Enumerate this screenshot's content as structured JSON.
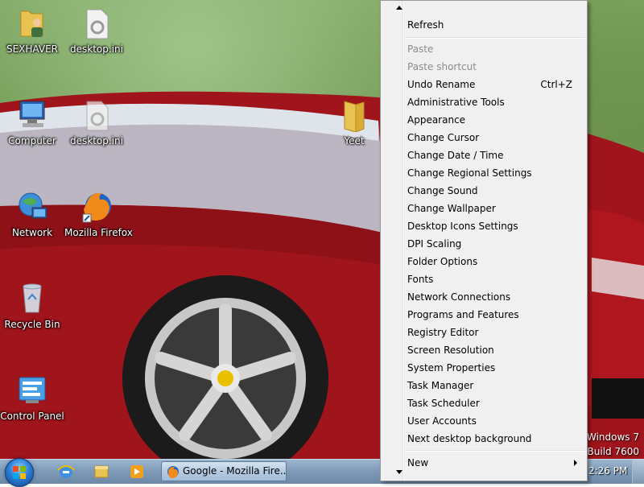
{
  "desktop": {
    "icons": [
      {
        "label": "SEXHAVER",
        "icon": "user-folder-icon"
      },
      {
        "label": "desktop.ini",
        "icon": "config-file-icon"
      },
      {
        "label": "Computer",
        "icon": "computer-icon"
      },
      {
        "label": "desktop.ini",
        "icon": "config-file-icon"
      },
      {
        "label": "Yeet",
        "icon": "folder-icon"
      },
      {
        "label": "Network",
        "icon": "network-icon"
      },
      {
        "label": "Mozilla Firefox",
        "icon": "firefox-icon"
      },
      {
        "label": "Recycle Bin",
        "icon": "recycle-bin-icon"
      },
      {
        "label": "Control Panel",
        "icon": "control-panel-icon"
      }
    ],
    "watermark": {
      "line1": "Windows 7",
      "line2": "Build 7600"
    }
  },
  "context_menu": {
    "scroll_up": "scroll-up-arrow-icon",
    "scroll_down": "scroll-down-arrow-icon",
    "items": [
      {
        "label": "Refresh",
        "disabled": false
      },
      {
        "label": "Paste",
        "disabled": true
      },
      {
        "label": "Paste shortcut",
        "disabled": true
      },
      {
        "label": "Undo Rename",
        "shortcut": "Ctrl+Z",
        "disabled": false
      },
      {
        "label": "Administrative Tools"
      },
      {
        "label": "Appearance"
      },
      {
        "label": "Change Cursor"
      },
      {
        "label": "Change Date / Time"
      },
      {
        "label": "Change Regional Settings"
      },
      {
        "label": "Change Sound"
      },
      {
        "label": "Change Wallpaper"
      },
      {
        "label": "Desktop Icons Settings"
      },
      {
        "label": "DPI Scaling"
      },
      {
        "label": "Folder Options"
      },
      {
        "label": "Fonts"
      },
      {
        "label": "Network Connections"
      },
      {
        "label": "Programs and Features"
      },
      {
        "label": "Registry Editor"
      },
      {
        "label": "Screen Resolution"
      },
      {
        "label": "System Properties"
      },
      {
        "label": "Task Manager"
      },
      {
        "label": "Task Scheduler"
      },
      {
        "label": "User Accounts"
      },
      {
        "label": "Next desktop background"
      },
      {
        "label": "New",
        "submenu": true
      }
    ]
  },
  "taskbar": {
    "pinned": [
      "internet-explorer-icon",
      "windows-explorer-icon",
      "media-player-icon"
    ],
    "task_button": {
      "label": "Google - Mozilla Fire..."
    },
    "clock": "2:26 PM"
  }
}
